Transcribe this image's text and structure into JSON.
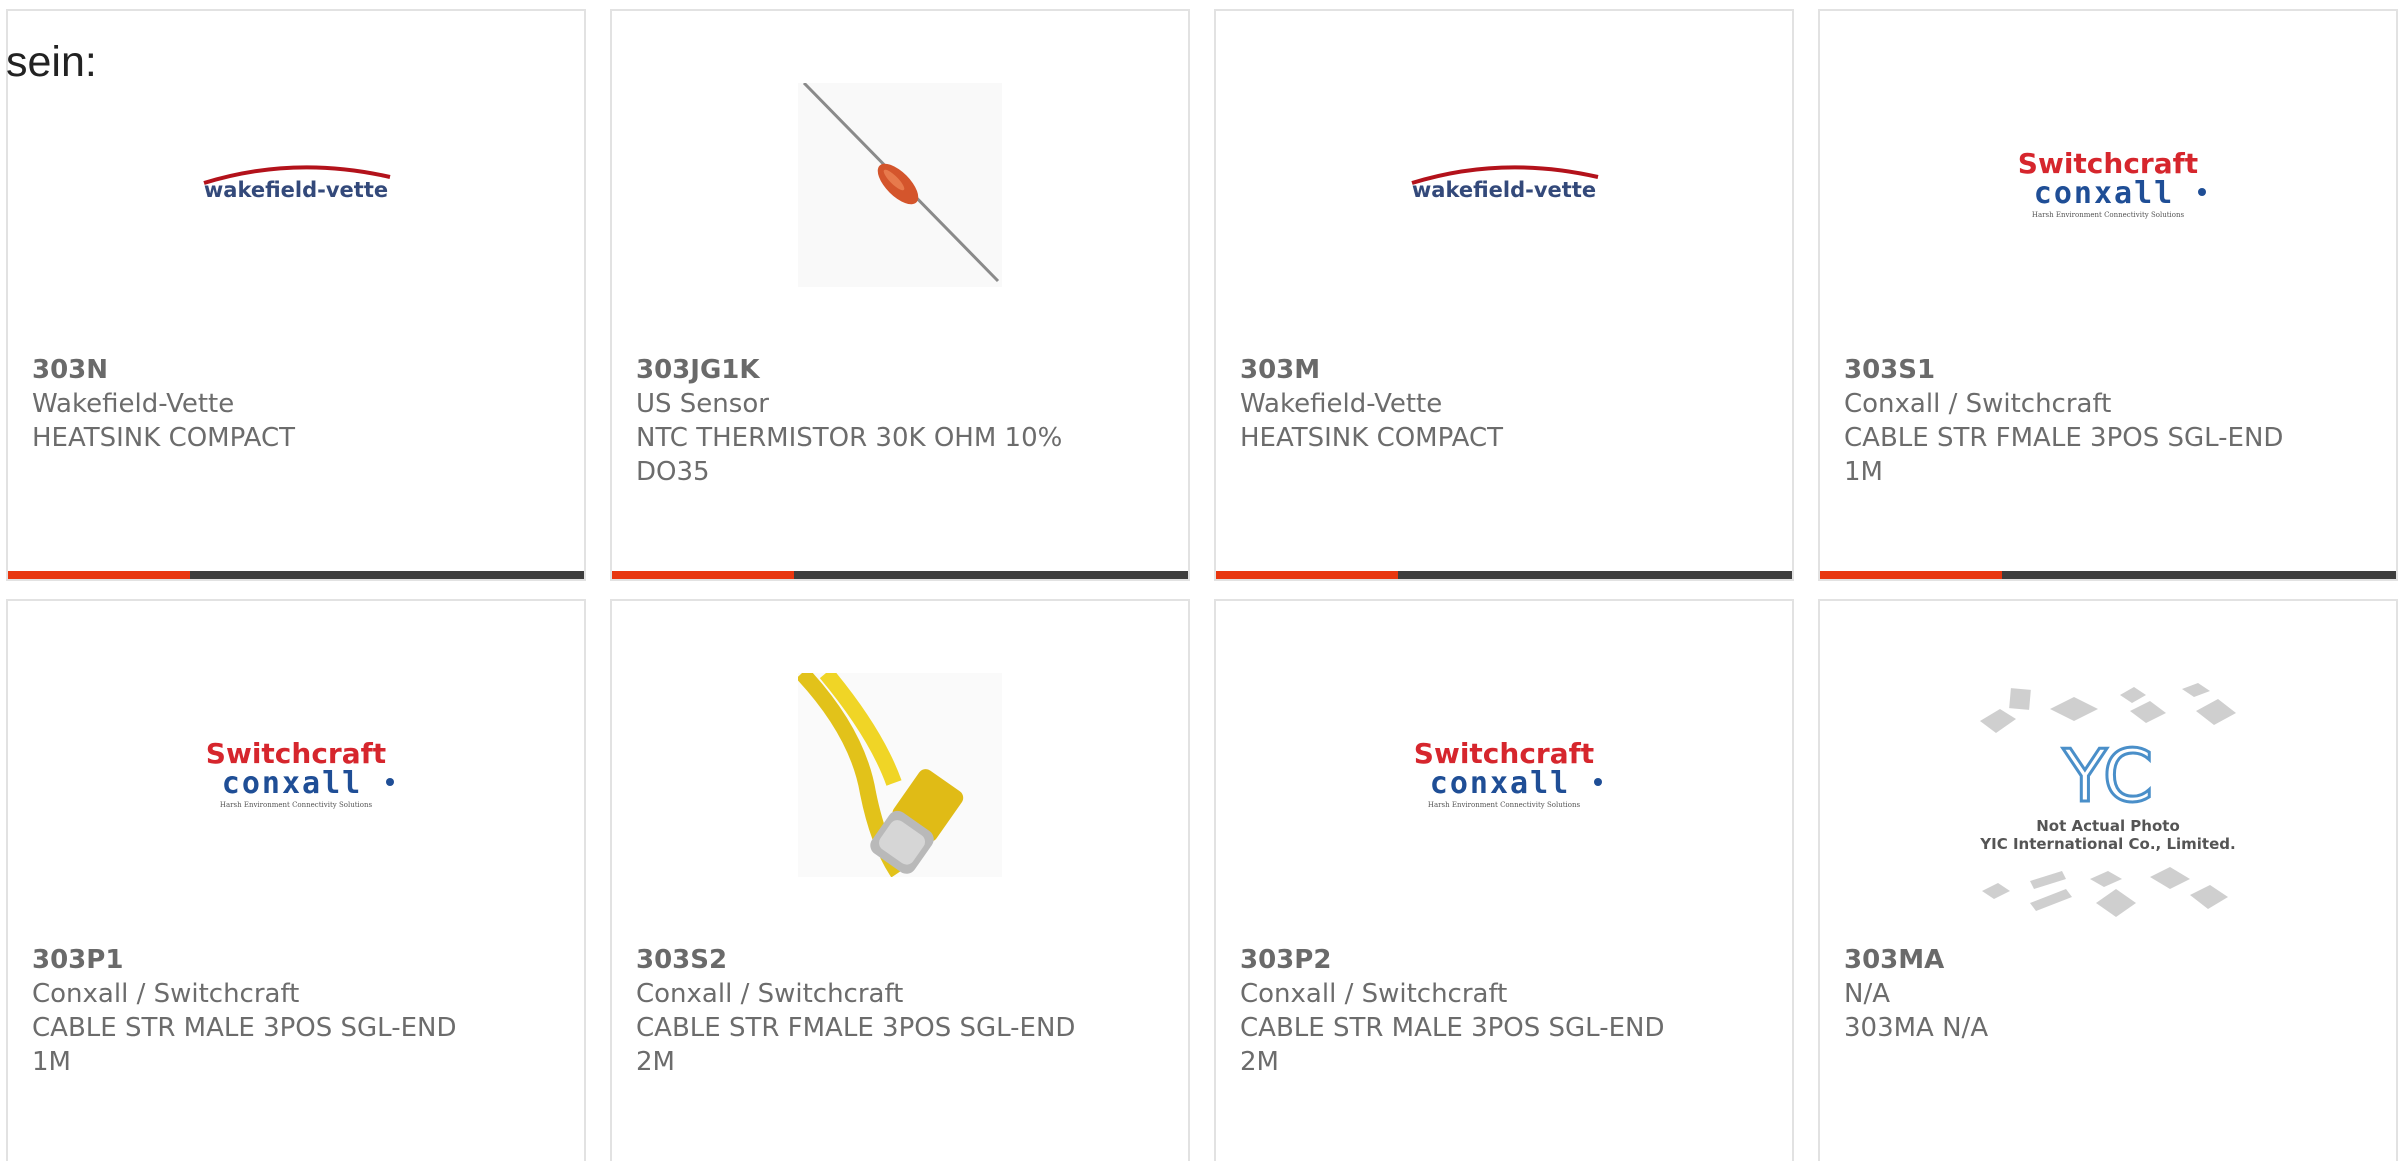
{
  "intro_text": "sein:",
  "colors": {
    "accent": "#e8360f",
    "bar": "#3d3d3d",
    "border": "#e2e2e2"
  },
  "logos": {
    "wakefield": "wakefield-vette",
    "switchcraft": "Switchcraft",
    "conxall": "conxall",
    "conxall_tagline": "Harsh Environment Connectivity Solutions"
  },
  "yic": {
    "line1": "Not Actual Photo",
    "line2": "YIC International Co., Limited."
  },
  "cards": [
    {
      "pn": "303N",
      "maker": "Wakefield-Vette",
      "desc": "HEATSINK COMPACT",
      "image": "wakefield-vette-logo"
    },
    {
      "pn": "303JG1K",
      "maker": "US Sensor",
      "desc": "NTC THERMISTOR 30K OHM 10% DO35",
      "image": "thermistor-photo"
    },
    {
      "pn": "303M",
      "maker": "Wakefield-Vette",
      "desc": "HEATSINK COMPACT",
      "image": "wakefield-vette-logo"
    },
    {
      "pn": "303S1",
      "maker": "Conxall / Switchcraft",
      "desc": "CABLE STR FMALE 3POS SGL-END 1M",
      "image": "switchcraft-conxall-logo"
    },
    {
      "pn": "303P1",
      "maker": "Conxall / Switchcraft",
      "desc": "CABLE STR MALE 3POS SGL-END 1M",
      "image": "switchcraft-conxall-logo"
    },
    {
      "pn": "303S2",
      "maker": "Conxall / Switchcraft",
      "desc": "CABLE STR FMALE 3POS SGL-END 2M",
      "image": "yellow-cable-photo"
    },
    {
      "pn": "303P2",
      "maker": "Conxall / Switchcraft",
      "desc": "CABLE STR MALE 3POS SGL-END 2M",
      "image": "switchcraft-conxall-logo"
    },
    {
      "pn": "303MA",
      "maker": "N/A",
      "desc": "303MA N/A",
      "image": "yic-placeholder"
    }
  ]
}
